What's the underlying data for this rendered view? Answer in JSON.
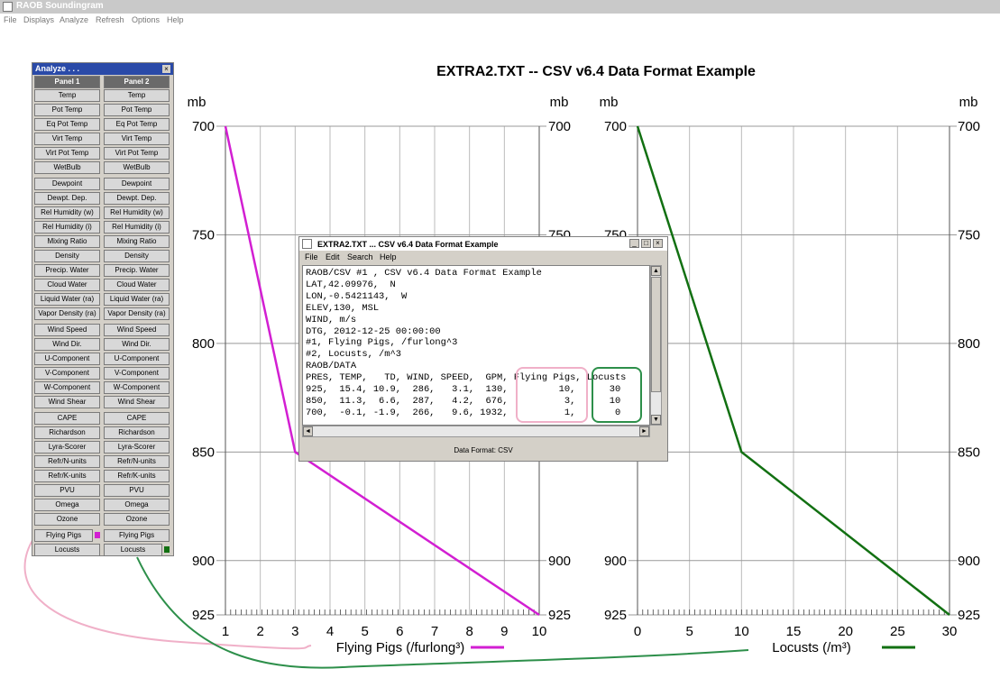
{
  "window": {
    "title": "RAOB Soundingram"
  },
  "menu": [
    "File",
    "Displays",
    "Analyze",
    "Refresh",
    "Options",
    "Help"
  ],
  "colors": {
    "pigs": "#d21fd2",
    "locusts": "#127012",
    "pigs_callout": "#f0b0c8",
    "locusts_callout": "#2d8f4a"
  },
  "analyze_panel": {
    "title": "Analyze . . .",
    "close_glyph": "×",
    "headers": [
      "Panel 1",
      "Panel 2"
    ],
    "rows": [
      {
        "p1": "Temp",
        "p2": "Temp"
      },
      {
        "p1": "Pot Temp",
        "p2": "Pot Temp"
      },
      {
        "p1": "Eq Pot Temp",
        "p2": "Eq Pot Temp"
      },
      {
        "p1": "Virt Temp",
        "p2": "Virt Temp"
      },
      {
        "p1": "Virt Pot Temp",
        "p2": "Virt Pot Temp"
      },
      {
        "p1": "WetBulb",
        "p2": "WetBulb"
      },
      {
        "p1": "Dewpoint",
        "p2": "Dewpoint"
      },
      {
        "p1": "Dewpt. Dep.",
        "p2": "Dewpt. Dep."
      },
      {
        "p1": "Rel Humidity (w)",
        "p2": "Rel Humidity (w)"
      },
      {
        "p1": "Rel Humidity (i)",
        "p2": "Rel Humidity (i)"
      },
      {
        "p1": "Mixing Ratio",
        "p2": "Mixing Ratio"
      },
      {
        "p1": "Density",
        "p2": "Density"
      },
      {
        "p1": "Precip. Water",
        "p2": "Precip. Water"
      },
      {
        "p1": "Cloud Water",
        "p2": "Cloud Water"
      },
      {
        "p1": "Liquid Water (ra)",
        "p2": "Liquid Water (ra)"
      },
      {
        "p1": "Vapor Density (ra)",
        "p2": "Vapor Density (ra)"
      },
      {
        "p1": "Wind Speed",
        "p2": "Wind Speed"
      },
      {
        "p1": "Wind Dir.",
        "p2": "Wind Dir."
      },
      {
        "p1": "U-Component",
        "p2": "U-Component"
      },
      {
        "p1": "V-Component",
        "p2": "V-Component"
      },
      {
        "p1": "W-Component",
        "p2": "W-Component"
      },
      {
        "p1": "Wind Shear",
        "p2": "Wind Shear"
      },
      {
        "p1": "CAPE",
        "p2": "CAPE"
      },
      {
        "p1": "Richardson",
        "p2": "Richardson"
      },
      {
        "p1": "Lyra-Scorer",
        "p2": "Lyra-Scorer"
      },
      {
        "p1": "Refr/N-units",
        "p2": "Refr/N-units"
      },
      {
        "p1": "Refr/K-units",
        "p2": "Refr/K-units"
      },
      {
        "p1": "PVU",
        "p2": "PVU"
      },
      {
        "p1": "Omega",
        "p2": "Omega"
      },
      {
        "p1": "Ozone",
        "p2": "Ozone"
      },
      {
        "p1": "Flying Pigs",
        "p2": "Flying Pigs"
      },
      {
        "p1": "Locusts",
        "p2": "Locusts"
      }
    ]
  },
  "chart_title": "EXTRA2.TXT  --  CSV v6.4 Data Format Example",
  "chart_data": [
    {
      "type": "line",
      "name": "Flying Pigs",
      "xlabel": "Flying Pigs (/furlong³)",
      "ylabel": "mb",
      "x_ticks": [
        "1",
        "2",
        "3",
        "4",
        "5",
        "6",
        "7",
        "8",
        "9",
        "10"
      ],
      "y_ticks": [
        "700",
        "750",
        "800",
        "850",
        "900",
        "925"
      ],
      "xlim": [
        1,
        10
      ],
      "ylim": [
        700,
        925
      ],
      "pres": [
        925,
        850,
        700
      ],
      "values": [
        10,
        3,
        1
      ],
      "color": "#d21fd2"
    },
    {
      "type": "line",
      "name": "Locusts",
      "xlabel": "Locusts (/m³)",
      "ylabel": "mb",
      "x_ticks": [
        "0",
        "5",
        "10",
        "15",
        "20",
        "25",
        "30"
      ],
      "y_ticks": [
        "700",
        "750",
        "800",
        "850",
        "900",
        "925"
      ],
      "xlim": [
        0,
        30
      ],
      "ylim": [
        700,
        925
      ],
      "pres": [
        925,
        850,
        700
      ],
      "values": [
        30,
        10,
        0
      ],
      "color": "#127012"
    }
  ],
  "data_window": {
    "title": "EXTRA2.TXT ... CSV v6.4 Data Format Example",
    "menu": [
      "File",
      "Edit",
      "Search",
      "Help"
    ],
    "lines": [
      "RAOB/CSV #1 , CSV v6.4 Data Format Example",
      "LAT,42.09976,  N",
      "LON,-0.5421143,  W",
      "ELEV,130, MSL",
      "WIND, m/s",
      "DTG, 2012-12-25 00:00:00",
      "#1, Flying Pigs, /furlong^3",
      "#2, Locusts, /m^3",
      "RAOB/DATA",
      "PRES, TEMP,   TD, WIND, SPEED,  GPM, Flying Pigs, Locusts",
      "925,  15.4, 10.9,  286,   3.1,  130,         10,      30",
      "850,  11.3,  6.6,  287,   4.2,  676,          3,      10",
      "700,  -0.1, -1.9,  266,   9.6, 1932,          1,       0"
    ],
    "status": "Data Format:  CSV"
  }
}
